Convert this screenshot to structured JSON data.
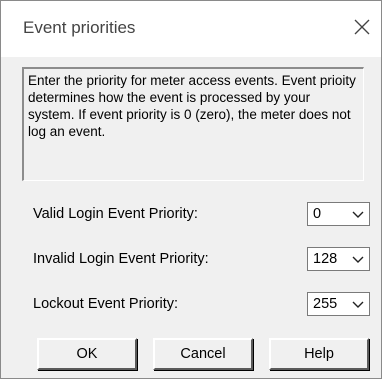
{
  "window": {
    "title": "Event priorities"
  },
  "info_text": "Enter the priority for meter access events.  Event prioity determines how the event is processed by your system.  If event priority is 0 (zero), the meter does not log an event.",
  "fields": [
    {
      "label": "Valid Login Event Priority:",
      "value": "0"
    },
    {
      "label": "Invalid Login Event Priority:",
      "value": "128"
    },
    {
      "label": "Lockout Event Priority:",
      "value": "255"
    }
  ],
  "buttons": {
    "ok": "OK",
    "cancel": "Cancel",
    "help": "Help"
  },
  "icons": {
    "close": "close-icon",
    "dropdown": "chevron-down-icon"
  }
}
